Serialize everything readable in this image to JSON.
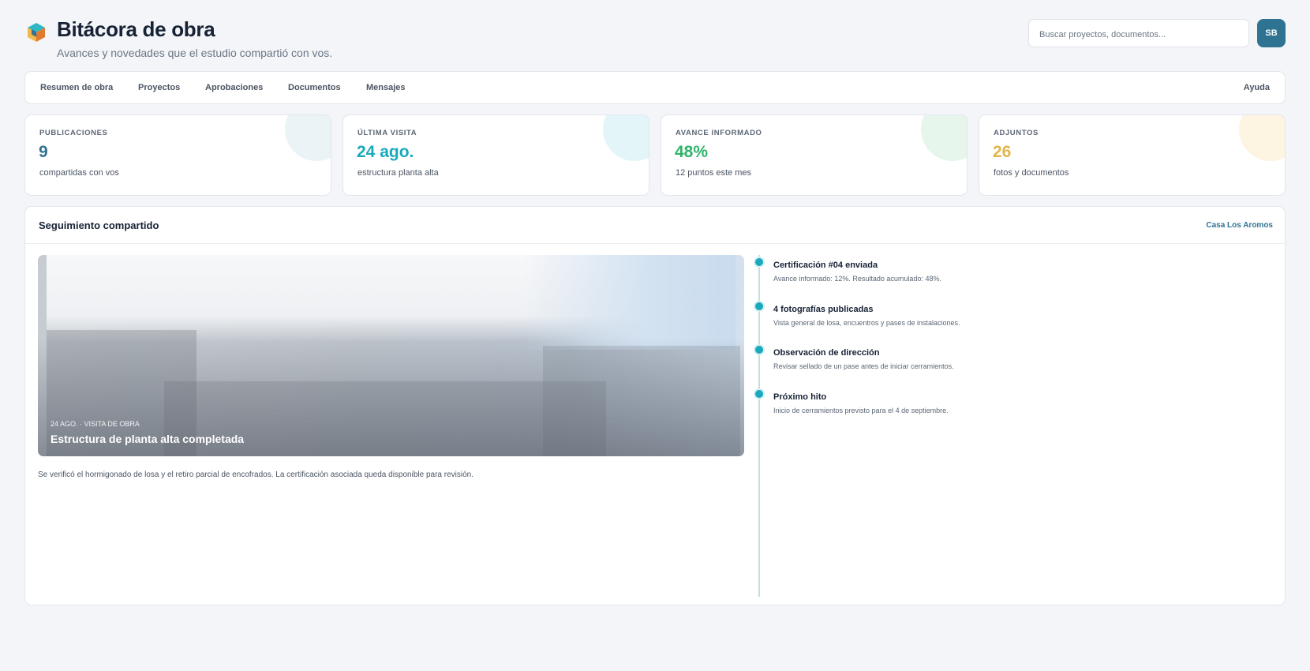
{
  "header": {
    "title": "Bitácora de obra",
    "subtitle": "Avances y novedades que el estudio compartió con vos.",
    "search_placeholder": "Buscar proyectos, documentos...",
    "avatar_initials": "SB"
  },
  "nav": {
    "items": [
      "Resumen de obra",
      "Proyectos",
      "Aprobaciones",
      "Documentos",
      "Mensajes"
    ],
    "help": "Ayuda"
  },
  "stats": [
    {
      "label": "PUBLICACIONES",
      "value": "9",
      "note": "compartidas con vos",
      "color": "#2f7393",
      "blob": "#eaf3f6"
    },
    {
      "label": "ÚLTIMA VISITA",
      "value": "24 ago.",
      "note": "estructura planta alta",
      "color": "#18a9bd",
      "blob": "#e3f5f8"
    },
    {
      "label": "AVANCE INFORMADO",
      "value": "48%",
      "note": "12 puntos este mes",
      "color": "#2fb36a",
      "blob": "#e6f6ec"
    },
    {
      "label": "ADJUNTOS",
      "value": "26",
      "note": "fotos y documentos",
      "color": "#e2b54a",
      "blob": "#fdf5e2"
    }
  ],
  "panel": {
    "title": "Seguimiento compartido",
    "project_link": "Casa Los Aromos",
    "photo": {
      "meta": "24 AGO. · VISITA DE OBRA",
      "title": "Estructura de planta alta completada"
    },
    "description": "Se verificó el hormigonado de losa y el retiro parcial de encofrados. La certificación asociada queda disponible para revisión.",
    "timeline": [
      {
        "title": "Certificación #04 enviada",
        "text": "Avance informado: 12%. Resultado acumulado: 48%."
      },
      {
        "title": "4 fotografías publicadas",
        "text": "Vista general de losa, encuentros y pases de instalaciones."
      },
      {
        "title": "Observación de dirección",
        "text": "Revisar sellado de un pase antes de iniciar cerramientos."
      },
      {
        "title": "Próximo hito",
        "text": "Inicio de cerramientos previsto para el 4 de septiembre."
      }
    ]
  }
}
